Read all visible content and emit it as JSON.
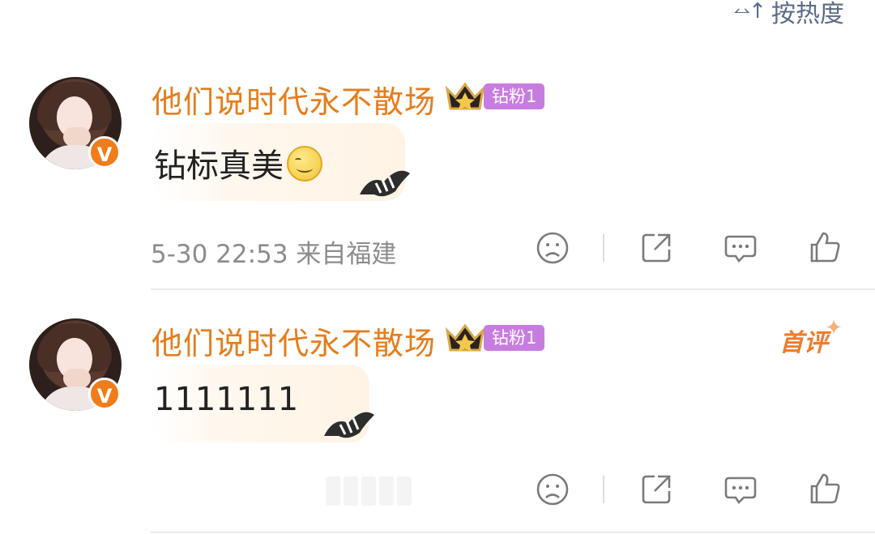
{
  "sort": {
    "label": "按热度",
    "icon": "sort-icon"
  },
  "comments": [
    {
      "username": "他们说时代永不散场",
      "fan_badge": "钻粉1",
      "text": "钻标真美",
      "has_emoji": true,
      "timestamp": "5-30 22:53",
      "location": "来自福建",
      "first_badge": ""
    },
    {
      "username": "他们说时代永不散场",
      "fan_badge": "钻粉1",
      "text": "1111111",
      "has_emoji": false,
      "timestamp": "",
      "location": "",
      "first_badge": "首评"
    }
  ],
  "colors": {
    "username": "#e57d1c",
    "fan_badge": "#c77de0",
    "verified": "#f07d1a",
    "icon": "#7a7a7a",
    "sort": "#5b6b86"
  }
}
